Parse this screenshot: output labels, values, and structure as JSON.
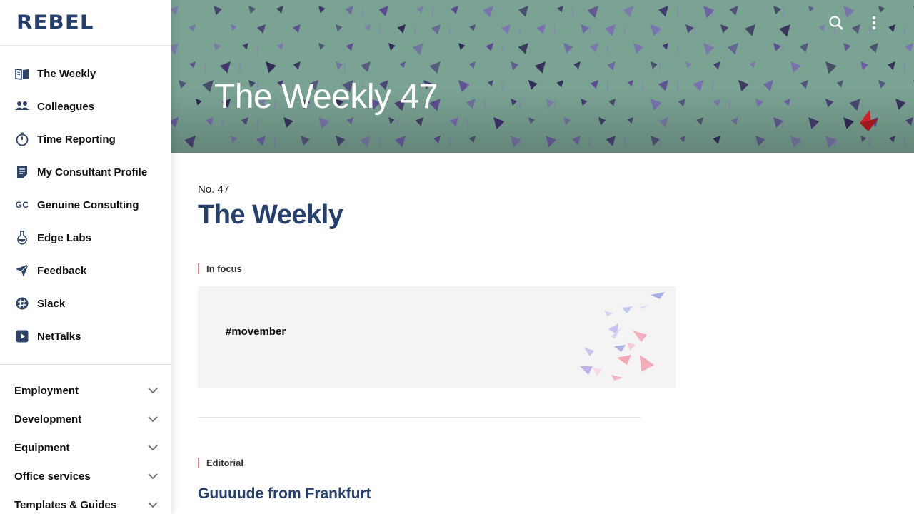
{
  "brand": {
    "logo_text": "REBEL"
  },
  "sidebar": {
    "items": [
      {
        "label": "The Weekly",
        "icon": "book-open-icon"
      },
      {
        "label": "Colleagues",
        "icon": "people-icon"
      },
      {
        "label": "Time Reporting",
        "icon": "stopwatch-icon"
      },
      {
        "label": "My Consultant Profile",
        "icon": "document-icon"
      },
      {
        "label": "Genuine Consulting",
        "icon": "gc-monogram-icon",
        "icon_text": "GC"
      },
      {
        "label": "Edge Labs",
        "icon": "flask-icon"
      },
      {
        "label": "Feedback",
        "icon": "paper-plane-icon"
      },
      {
        "label": "Slack",
        "icon": "slack-icon"
      },
      {
        "label": "NetTalks",
        "icon": "play-icon"
      }
    ],
    "groups": [
      {
        "label": "Employment"
      },
      {
        "label": "Development"
      },
      {
        "label": "Equipment"
      },
      {
        "label": "Office services"
      },
      {
        "label": "Templates & Guides"
      }
    ]
  },
  "header": {
    "title": "The Weekly 47",
    "search_icon": "search-icon",
    "menu_icon": "more-vertical-icon",
    "background_color": "#7aa394"
  },
  "main": {
    "issue_no": "No. 47",
    "title": "The Weekly",
    "in_focus": {
      "label": "In focus",
      "card_tag": "#movember"
    },
    "editorial": {
      "label": "Editorial",
      "article_title": "Guuuude from Frankfurt"
    }
  },
  "colors": {
    "brand_navy": "#26406b",
    "section_accent": "#d98a8f",
    "card_bg": "#f4f4f4"
  }
}
